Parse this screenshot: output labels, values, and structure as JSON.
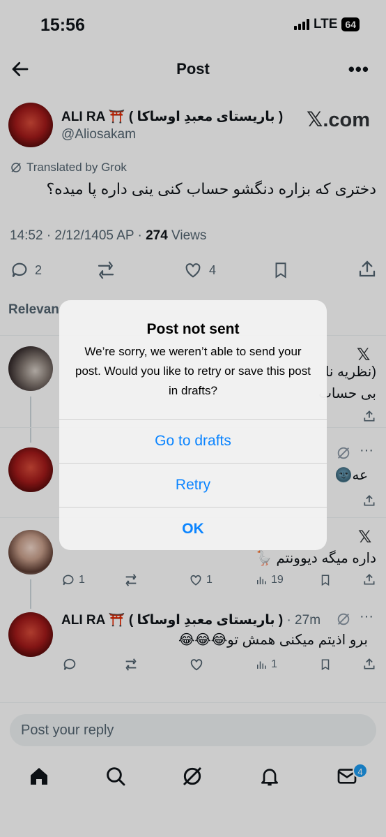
{
  "status_bar": {
    "time": "15:56",
    "network": "LTE",
    "battery": "64"
  },
  "header": {
    "title": "Post"
  },
  "post": {
    "author_name": "ALI RA ⛩️ ( باریستای معبدِ اوساکا )",
    "handle": "@Aliosakam",
    "brand": "𝕏.com",
    "translated_label": "Translated by Grok",
    "text": "دختری که بزاره دنگشو حساب کنی ینی داره پا میده؟",
    "time": "14:52 · 2/12/1405 AP · ",
    "views_count": "274",
    "views_label": " Views",
    "replies": "2",
    "likes": "4"
  },
  "section_label": "Relevan",
  "replies": [
    {
      "text_line1": "(نظریه نا",
      "text_line2": "بی حساب"
    },
    {
      "text": "عه🌚"
    },
    {
      "text": "داره میگه دیوونتم 🪿",
      "replies": "1",
      "likes": "1",
      "views": "19"
    },
    {
      "name": "ALI RA ⛩️ ( باریستای معبدِ اوساکا )",
      "time": "· 27m",
      "text": "برو اذیتم میکنی همش تو😂😂😂",
      "views": "1"
    }
  ],
  "reply_input": {
    "placeholder": "Post your reply"
  },
  "dialog": {
    "title": "Post not sent",
    "message": "We’re sorry, we weren’t able to send your post. Would you like to retry or save this post in drafts?",
    "drafts_label": "Go to drafts",
    "retry_label": "Retry",
    "ok_label": "OK"
  },
  "nav": {
    "messages_badge": "4"
  }
}
